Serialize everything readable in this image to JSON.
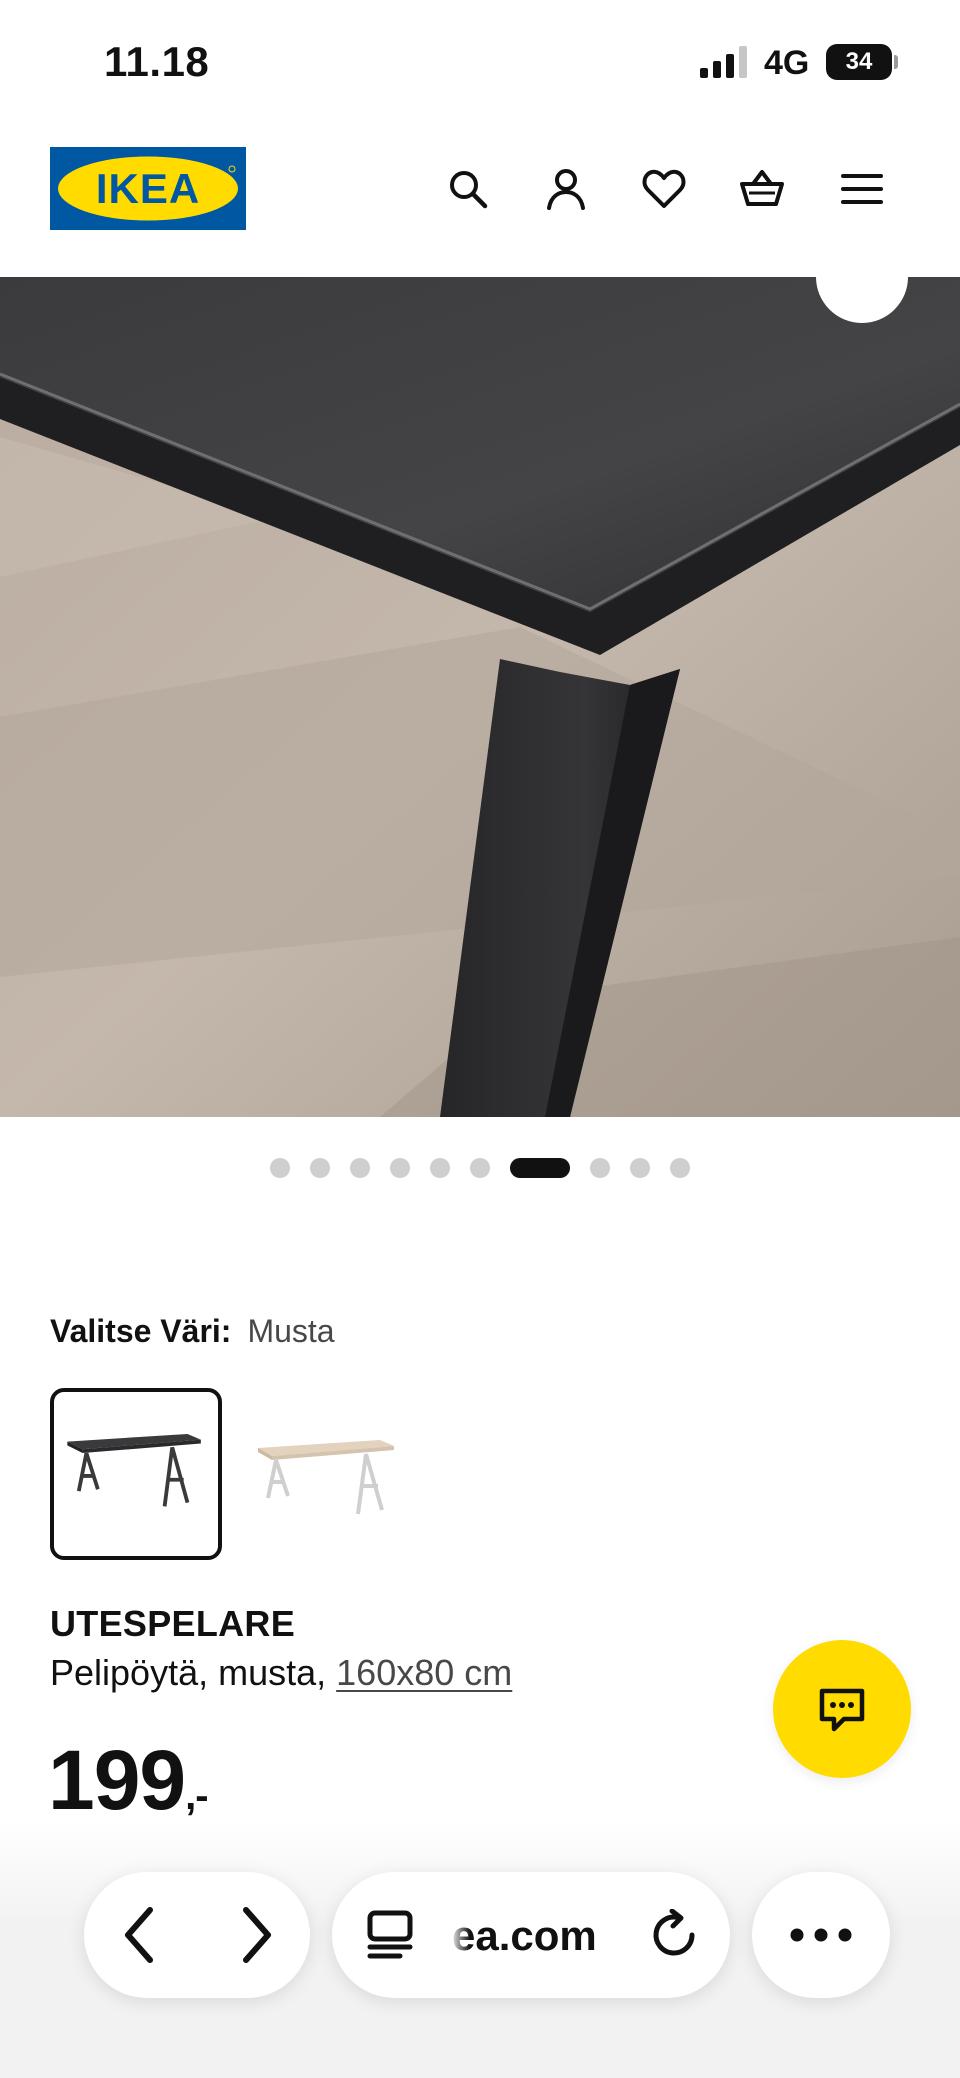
{
  "status_bar": {
    "time": "11.18",
    "network": "4G",
    "battery": "34"
  },
  "header": {
    "logo_text": "IKEA",
    "icons": [
      "search-icon",
      "profile-icon",
      "heart-icon",
      "basket-icon",
      "menu-icon"
    ]
  },
  "colors": {
    "ikea_blue": "#0058a3",
    "ikea_yellow": "#ffdb00",
    "text": "#111111"
  },
  "carousel": {
    "total_images": 10,
    "active_index": 7
  },
  "color_picker": {
    "label": "Valitse Väri:",
    "selected_value": "Musta",
    "options": [
      "Musta",
      "Valkoinen/puukuvio"
    ]
  },
  "product": {
    "name": "UTESPELARE",
    "description": "Pelipöytä, musta,",
    "size": "160x80 cm",
    "price": "199",
    "price_suffix": ",-"
  },
  "browser": {
    "url": "ea.com"
  }
}
